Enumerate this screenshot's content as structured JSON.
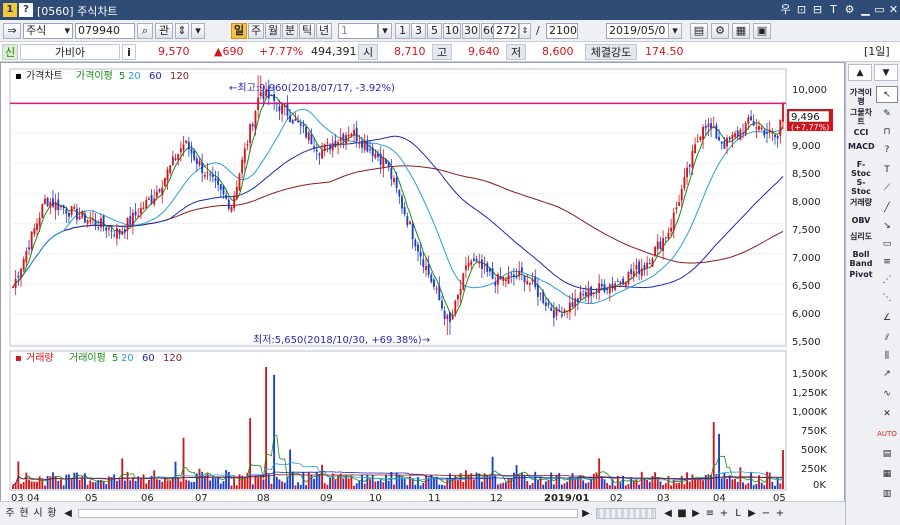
{
  "window": {
    "app_badge": "1",
    "help_badge": "?",
    "title": "[0560] 주식차트",
    "controls": [
      "우",
      "⊡",
      "⊟",
      "T",
      "⚙",
      "▁",
      "▭",
      "✕"
    ]
  },
  "toolbar": {
    "market": "주식",
    "code": "079940",
    "search_icon": "search-icon",
    "gwan": "관",
    "period_buttons": [
      {
        "label": "일",
        "selected": true
      },
      {
        "label": "주",
        "selected": false
      },
      {
        "label": "월",
        "selected": false
      },
      {
        "label": "분",
        "selected": false
      },
      {
        "label": "틱",
        "selected": false
      },
      {
        "label": "년",
        "selected": false
      }
    ],
    "interval_value": "1",
    "minute_buttons": [
      "1",
      "3",
      "5",
      "10",
      "30",
      "60"
    ],
    "count_value": "272",
    "slash": "/",
    "total_value": "2100",
    "date_value": "2019/05/0",
    "icons": [
      "save-icon",
      "settings-icon",
      "layout-icon",
      "window-icon"
    ]
  },
  "quote": {
    "badge": "신",
    "name": "가비아",
    "info": "i",
    "price": "9,570",
    "change": "▲690",
    "change_pct": "+7.77%",
    "volume": "494,391",
    "open_label": "시",
    "open": "8,710",
    "high_label": "고",
    "high": "9,640",
    "low_label": "저",
    "low": "8,600",
    "strength_label": "체결강도",
    "strength": "174.50",
    "period_badge": "[1일]"
  },
  "chart": {
    "legend_price": {
      "name": "가격차트",
      "ma_label": "가격이평",
      "ma_periods": [
        "5",
        "20",
        "60",
        "120"
      ]
    },
    "legend_volume": {
      "name": "거래량",
      "ma_label": "거래이평",
      "ma_periods": [
        "5",
        "20",
        "60",
        "120"
      ]
    },
    "price_ticks": [
      "10,000",
      "9,500",
      "9,000",
      "8,500",
      "8,000",
      "7,500",
      "7,000",
      "6,500",
      "6,000",
      "5,500"
    ],
    "volume_ticks": [
      "1,500K",
      "1,250K",
      "1,000K",
      "750K",
      "500K",
      "250K",
      "0K"
    ],
    "x_labels": [
      "03",
      "04",
      "05",
      "06",
      "07",
      "08",
      "09",
      "10",
      "11",
      "12",
      "2019/01",
      "02",
      "03",
      "04",
      "05"
    ],
    "high_note": "←최고:9,960(2018/07/17, -3.92%)",
    "low_note": "최저:5,650(2018/10/30, +69.38%)→",
    "current_price": "9,496",
    "current_pct": "(+7.77%)",
    "ma_colors": {
      "ma5": "#1a8a1a",
      "ma20": "#2aa0d8",
      "ma60": "#1c2ab0",
      "ma120": "#8a1c1c"
    },
    "up_color": "#d4141a",
    "down_color": "#1a3ec8",
    "ref_line_color": "#e0157a"
  },
  "chart_data": {
    "type": "candlestick",
    "title": "",
    "y_range": [
      5500,
      10000
    ],
    "volume_range": [
      0,
      1600000
    ],
    "x_range": [
      "2018/03",
      "2019/05"
    ],
    "high": {
      "value": 9960,
      "date": "2018/07/17"
    },
    "low": {
      "value": 5650,
      "date": "2018/10/30"
    },
    "reference_line": 9496,
    "price_anchor_points": [
      [
        "2018/03/02",
        6450
      ],
      [
        "2018/03/20",
        7900
      ],
      [
        "2018/04/10",
        7600
      ],
      [
        "2018/04/30",
        7350
      ],
      [
        "2018/05/20",
        8000
      ],
      [
        "2018/06/05",
        8850
      ],
      [
        "2018/06/20",
        8200
      ],
      [
        "2018/07/01",
        7800
      ],
      [
        "2018/07/17",
        9700
      ],
      [
        "2018/08/01",
        9350
      ],
      [
        "2018/08/20",
        8700
      ],
      [
        "2018/09/05",
        9050
      ],
      [
        "2018/09/25",
        8500
      ],
      [
        "2018/10/10",
        7300
      ],
      [
        "2018/10/30",
        5800
      ],
      [
        "2018/11/10",
        6900
      ],
      [
        "2018/11/25",
        6550
      ],
      [
        "2018/12/10",
        6650
      ],
      [
        "2018/12/28",
        6000
      ],
      [
        "2019/01/15",
        6350
      ],
      [
        "2019/02/01",
        6550
      ],
      [
        "2019/02/15",
        6800
      ],
      [
        "2019/03/01",
        7400
      ],
      [
        "2019/03/20",
        9200
      ],
      [
        "2019/04/01",
        8800
      ],
      [
        "2019/04/15",
        9200
      ],
      [
        "2019/04/30",
        8900
      ],
      [
        "2019/05/03",
        9496
      ]
    ],
    "volume_note": "volume spikes near 2018/07/20 (~1,550K), 2019/03/25 (~850K), 2019/05/03 (~494K)"
  },
  "tools": {
    "words": [
      "가격이평",
      "그물차트",
      "CCI",
      "MACD",
      "F-Stoc",
      "S-Stoc",
      "거래량",
      "OBV",
      "심리도",
      "Boll Band",
      "Pivot"
    ],
    "icons": [
      "cursor-icon",
      "eraser-icon",
      "magnet-icon",
      "help-icon",
      "text-icon",
      "line-icon",
      "trend-line-icon",
      "ray-icon",
      "rectangle-icon",
      "fibonacci-icon",
      "speed-line-icon",
      "gann-icon",
      "angle-icon",
      "channel-icon",
      "auto-icon",
      "print-icon",
      "grid-icon"
    ]
  },
  "bottom": {
    "tabs": [
      "주",
      "현",
      "시",
      "황"
    ],
    "nav": [
      "◀",
      "▶",
      "◀",
      "■",
      "▶",
      "≡",
      "+",
      "L",
      "▶",
      "−",
      "+"
    ]
  }
}
